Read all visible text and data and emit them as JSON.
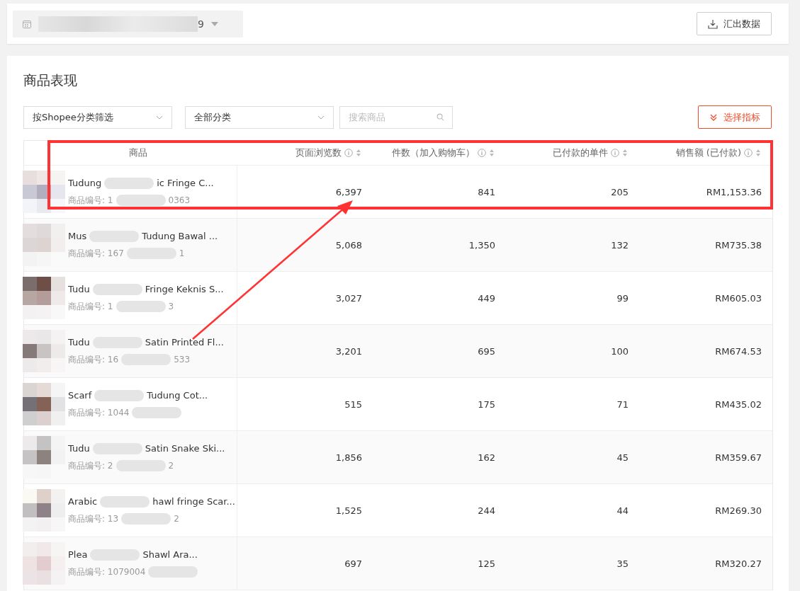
{
  "date_field": {
    "value": "9"
  },
  "export_button": {
    "label": "汇出数据"
  },
  "section_title": "商品表现",
  "filters": [
    {
      "kind": "dropdown",
      "value": "按Shopee分类筛选"
    },
    {
      "kind": "dropdown",
      "value": "全部分类"
    },
    {
      "kind": "search",
      "placeholder": "搜索商品"
    }
  ],
  "metrics_button": {
    "label": "选择指标"
  },
  "table": {
    "columns": [
      "商品",
      "页面浏览数",
      "件数（加入购物车）",
      "已付款的单件",
      "销售额 (已付款)"
    ],
    "rows": [
      {
        "name_parts": [
          "Tudung",
          "ic Fringe C..."
        ],
        "id_parts": [
          "商品编号: 1",
          "0363"
        ],
        "cells": [
          "6,397",
          "841",
          "205",
          "RM1,153.36"
        ]
      },
      {
        "name_parts": [
          "Mus",
          "Tudung Bawal ..."
        ],
        "id_parts": [
          "商品编号: 167",
          "1"
        ],
        "cells": [
          "5,068",
          "1,350",
          "132",
          "RM735.38"
        ]
      },
      {
        "name_parts": [
          "Tudu",
          "Fringe Keknis S..."
        ],
        "id_parts": [
          "商品编号: 1",
          "3"
        ],
        "cells": [
          "3,027",
          "449",
          "99",
          "RM605.03"
        ]
      },
      {
        "name_parts": [
          "Tudu",
          "Satin Printed Fl..."
        ],
        "id_parts": [
          "商品编号: 16",
          "533"
        ],
        "cells": [
          "3,201",
          "695",
          "100",
          "RM674.53"
        ]
      },
      {
        "name_parts": [
          "Scarf",
          "Tudung Cot..."
        ],
        "id_parts": [
          "商品编号: 1044"
        ],
        "cells": [
          "515",
          "175",
          "71",
          "RM435.02"
        ]
      },
      {
        "name_parts": [
          "Tudu",
          "Satin Snake Ski..."
        ],
        "id_parts": [
          "商品编号: 2",
          "2"
        ],
        "cells": [
          "1,856",
          "162",
          "45",
          "RM359.67"
        ]
      },
      {
        "name_parts": [
          "Arabic",
          "hawl fringe Scar..."
        ],
        "id_parts": [
          "商品编号: 13",
          "2"
        ],
        "cells": [
          "1,525",
          "244",
          "44",
          "RM269.30"
        ]
      },
      {
        "name_parts": [
          "Plea",
          "Shawl Ara..."
        ],
        "id_parts": [
          "商品编号: 1079004"
        ],
        "cells": [
          "697",
          "125",
          "35",
          "RM320.27"
        ]
      }
    ]
  }
}
